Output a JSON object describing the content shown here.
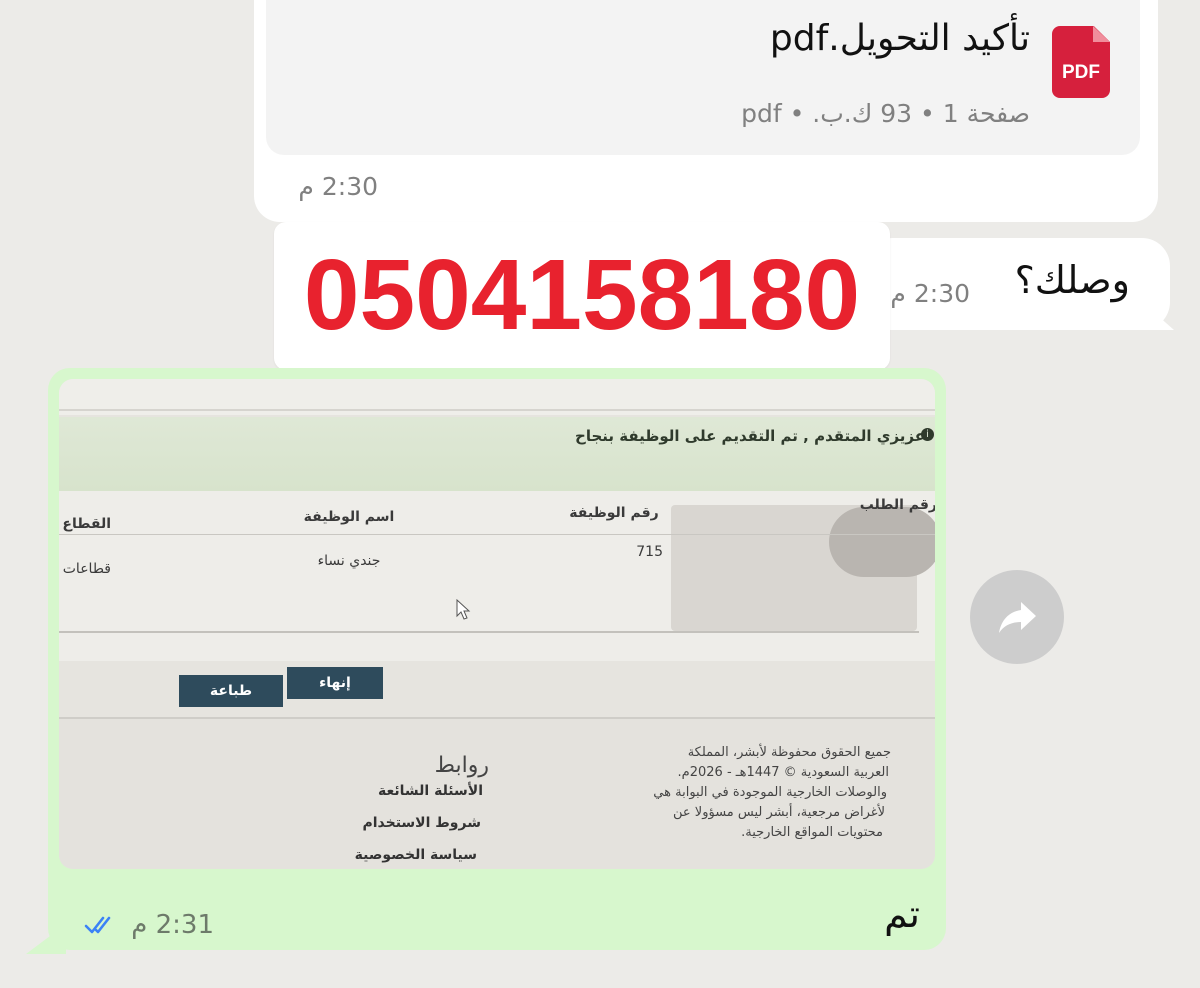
{
  "chat": {
    "pdf_message": {
      "icon_label": "PDF",
      "filename": "تأكيد التحويل.pdf",
      "meta": "صفحة 1 • 93 ك.ب. • pdf",
      "time": "2:30 م"
    },
    "text_message": {
      "text": "وصلك؟",
      "time": "2:30 م"
    },
    "overlay": {
      "phone_number": "0504158180"
    },
    "outgoing_message": {
      "text": "تم",
      "time": "2:31 م",
      "status": "read",
      "check_color": "#3b82f6",
      "photo": {
        "success_text": "عزيزي المتقدم , تم التقديم على الوظيفة بنجاح",
        "columns": [
          "رقم الطلب",
          "رقم الوظيفة",
          "اسم الوظيفة",
          "القطاع"
        ],
        "row": {
          "job_number": "715",
          "job_name": "جندي نساء",
          "sector": "قطاعات"
        },
        "buttons": {
          "end": "إنهاء",
          "print": "طباعة"
        },
        "links_title": "روابط",
        "links": [
          "الأسئلة الشائعة",
          "شروط الاستخدام",
          "سياسة الخصوصية"
        ],
        "legal_lines": [
          "جميع الحقوق محفوظة لأبشر، المملكة",
          "العربية السعودية © 1447هـ - 2026م.",
          "والوصلات الخارجية الموجودة في البوابة هي",
          "لأغراض مرجعية، أبشر ليس مسؤولا عن",
          "محتويات المواقع الخارجية."
        ]
      }
    }
  },
  "colors": {
    "background": "#ecebe8",
    "incoming_bubble": "#ffffff",
    "outgoing_bubble": "#d7f7cd",
    "pdf_red": "#d6203d",
    "phone_red": "#e8222e"
  },
  "icons": {
    "pdf": "pdf-file-icon",
    "forward": "forward-arrow-icon",
    "read_receipt": "double-check-icon"
  }
}
